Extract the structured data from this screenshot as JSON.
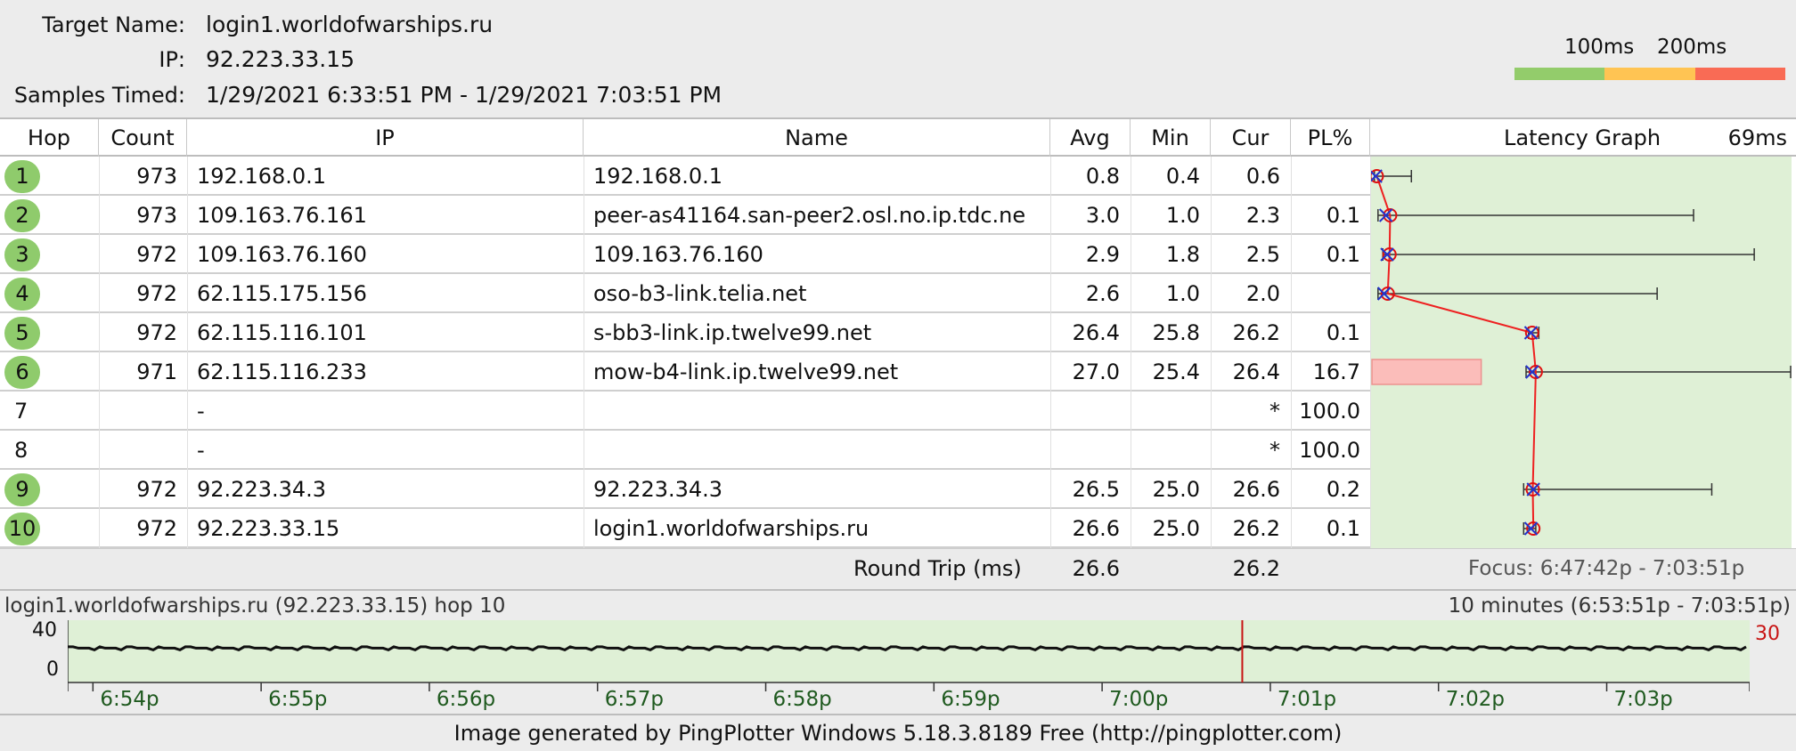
{
  "header": {
    "target_label": "Target Name:",
    "target_value": "login1.worldofwarships.ru",
    "ip_label": "IP:",
    "ip_value": "92.223.33.15",
    "samples_label": "Samples Timed:",
    "samples_value": "1/29/2021 6:33:51 PM - 1/29/2021 7:03:51 PM"
  },
  "scale": {
    "label_100": "100ms",
    "label_200": "200ms",
    "colors": [
      "#93cc6b",
      "#ffc453",
      "#f96b55"
    ]
  },
  "columns": {
    "hop": "Hop",
    "count": "Count",
    "ip": "IP",
    "name": "Name",
    "avg": "Avg",
    "min": "Min",
    "cur": "Cur",
    "pl": "PL%",
    "latency_graph": "Latency Graph",
    "latency_max": "69ms"
  },
  "hops": [
    {
      "hop": "1",
      "count": "973",
      "ip": "192.168.0.1",
      "name": "192.168.0.1",
      "avg": "0.8",
      "min": "0.4",
      "cur": "0.6",
      "pl": "",
      "responding": true,
      "avg_ms": 0.8,
      "min_ms": 0.4,
      "max_ms": 6.5,
      "cur_ms": 0.6,
      "pl_value": 0
    },
    {
      "hop": "2",
      "count": "973",
      "ip": "109.163.76.161",
      "name": "peer-as41164.san-peer2.osl.no.ip.tdc.ne",
      "avg": "3.0",
      "min": "1.0",
      "cur": "2.3",
      "pl": "0.1",
      "responding": true,
      "avg_ms": 3.0,
      "min_ms": 1.0,
      "max_ms": 53,
      "cur_ms": 2.3,
      "pl_value": 0.1
    },
    {
      "hop": "3",
      "count": "972",
      "ip": "109.163.76.160",
      "name": "109.163.76.160",
      "avg": "2.9",
      "min": "1.8",
      "cur": "2.5",
      "pl": "0.1",
      "responding": true,
      "avg_ms": 2.9,
      "min_ms": 1.8,
      "max_ms": 63,
      "cur_ms": 2.5,
      "pl_value": 0.1
    },
    {
      "hop": "4",
      "count": "972",
      "ip": "62.115.175.156",
      "name": "oso-b3-link.telia.net",
      "avg": "2.6",
      "min": "1.0",
      "cur": "2.0",
      "pl": "",
      "responding": true,
      "avg_ms": 2.6,
      "min_ms": 1.0,
      "max_ms": 47,
      "cur_ms": 2.0,
      "pl_value": 0
    },
    {
      "hop": "5",
      "count": "972",
      "ip": "62.115.116.101",
      "name": "s-bb3-link.ip.twelve99.net",
      "avg": "26.4",
      "min": "25.8",
      "cur": "26.2",
      "pl": "0.1",
      "responding": true,
      "avg_ms": 26.4,
      "min_ms": 25.8,
      "max_ms": 27.5,
      "cur_ms": 26.2,
      "pl_value": 0.1
    },
    {
      "hop": "6",
      "count": "971",
      "ip": "62.115.116.233",
      "name": "mow-b4-link.ip.twelve99.net",
      "avg": "27.0",
      "min": "25.4",
      "cur": "26.4",
      "pl": "16.7",
      "responding": true,
      "avg_ms": 27.0,
      "min_ms": 25.4,
      "max_ms": 69,
      "cur_ms": 26.4,
      "pl_value": 16.7
    },
    {
      "hop": "7",
      "count": "",
      "ip": "-",
      "name": "",
      "avg": "",
      "min": "",
      "cur": "*",
      "pl": "100.0",
      "responding": false,
      "pl_value": 100
    },
    {
      "hop": "8",
      "count": "",
      "ip": "-",
      "name": "",
      "avg": "",
      "min": "",
      "cur": "*",
      "pl": "100.0",
      "responding": false,
      "pl_value": 100
    },
    {
      "hop": "9",
      "count": "972",
      "ip": "92.223.34.3",
      "name": "92.223.34.3",
      "avg": "26.5",
      "min": "25.0",
      "cur": "26.6",
      "pl": "0.2",
      "responding": true,
      "avg_ms": 26.5,
      "min_ms": 25.0,
      "max_ms": 56,
      "cur_ms": 26.6,
      "pl_value": 0.2
    },
    {
      "hop": "10",
      "count": "972",
      "ip": "92.223.33.15",
      "name": "login1.worldofwarships.ru",
      "avg": "26.6",
      "min": "25.0",
      "cur": "26.2",
      "pl": "0.1",
      "responding": true,
      "avg_ms": 26.6,
      "min_ms": 25.0,
      "max_ms": 27.0,
      "cur_ms": 26.2,
      "pl_value": 0.1
    }
  ],
  "round_trip": {
    "label": "Round Trip (ms)",
    "avg": "26.6",
    "cur": "26.2",
    "focus": "Focus: 6:47:42p - 7:03:51p"
  },
  "timeline": {
    "title": "login1.worldofwarships.ru (92.223.33.15) hop 10",
    "range": "10 minutes (6:53:51p - 7:03:51p)",
    "y_ticks": [
      "40",
      "0"
    ],
    "right_value": "30",
    "x_ticks": [
      "6:54p",
      "6:55p",
      "6:56p",
      "6:57p",
      "6:58p",
      "6:59p",
      "7:00p",
      "7:01p",
      "7:02p",
      "7:03p"
    ],
    "latency_level_ms": 26.5,
    "marker_time": "7:00:50p"
  },
  "credit": "Image generated by PingPlotter Windows 5.18.3.8189 Free (http://pingplotter.com)"
}
